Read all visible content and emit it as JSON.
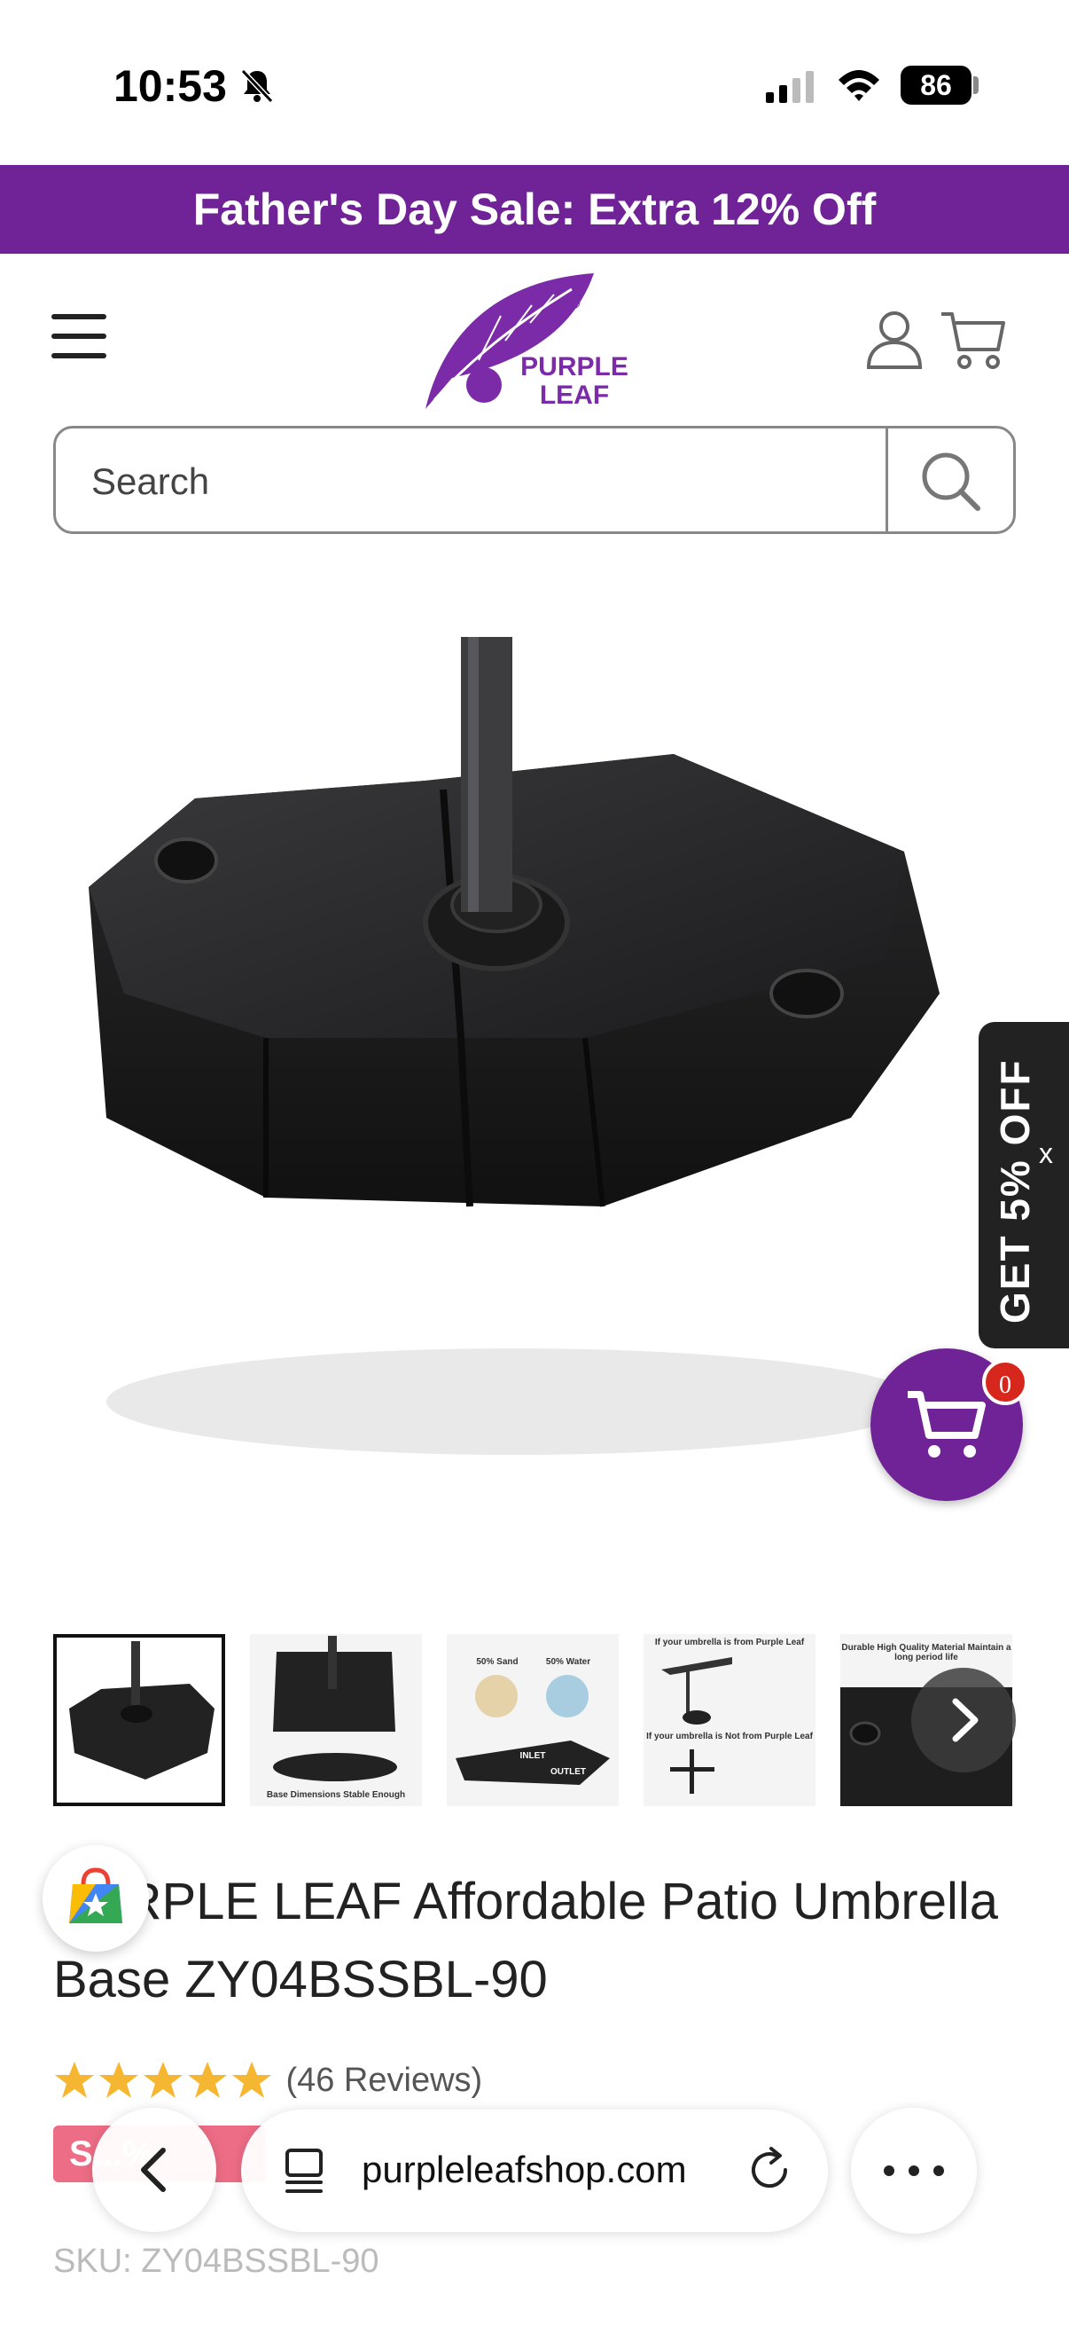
{
  "status_bar": {
    "time": "10:53",
    "battery": "86",
    "icons": [
      "bell-slash-icon",
      "cellular-signal-icon",
      "wifi-icon",
      "battery-icon"
    ]
  },
  "promo_banner": {
    "text": "Father's Day Sale: Extra 12% Off",
    "background": "#6f2396"
  },
  "header": {
    "logo_text_line1": "PURPLE",
    "logo_text_line2": "LEAF",
    "icons": [
      "menu-icon",
      "account-icon",
      "cart-icon"
    ]
  },
  "search": {
    "placeholder": "Search"
  },
  "discount_tab": {
    "text": "GET 5% OFF",
    "close": "x"
  },
  "floating_cart": {
    "count": "0"
  },
  "thumbnails": [
    {
      "caption": ""
    },
    {
      "caption": "Base Dimensions Stable Enough"
    },
    {
      "caption_top_left": "50% Sand",
      "caption_top_right": "50% Water",
      "caption_inlet": "INLET",
      "caption_outlet": "OUTLET"
    },
    {
      "caption_top": "If your umbrella is from Purple Leaf",
      "caption_mid": "If your umbrella is Not from Purple Leaf"
    },
    {
      "caption": "Durable High Quality Material Maintain a long period life"
    }
  ],
  "product": {
    "title": "PURPLE LEAF Affordable Patio Umbrella Base ZY04BSSBL-90",
    "rating": 5,
    "reviews": "(46 Reviews)",
    "sale_badge": "S...%",
    "sku": "SKU: ZY04BSSBL-90"
  },
  "browser": {
    "url": "purpleleafshop.com"
  },
  "colors": {
    "brand_purple": "#6f2396",
    "star": "#f5b731",
    "badge_red": "#d7271c",
    "sale_pink": "#ee6d86"
  }
}
